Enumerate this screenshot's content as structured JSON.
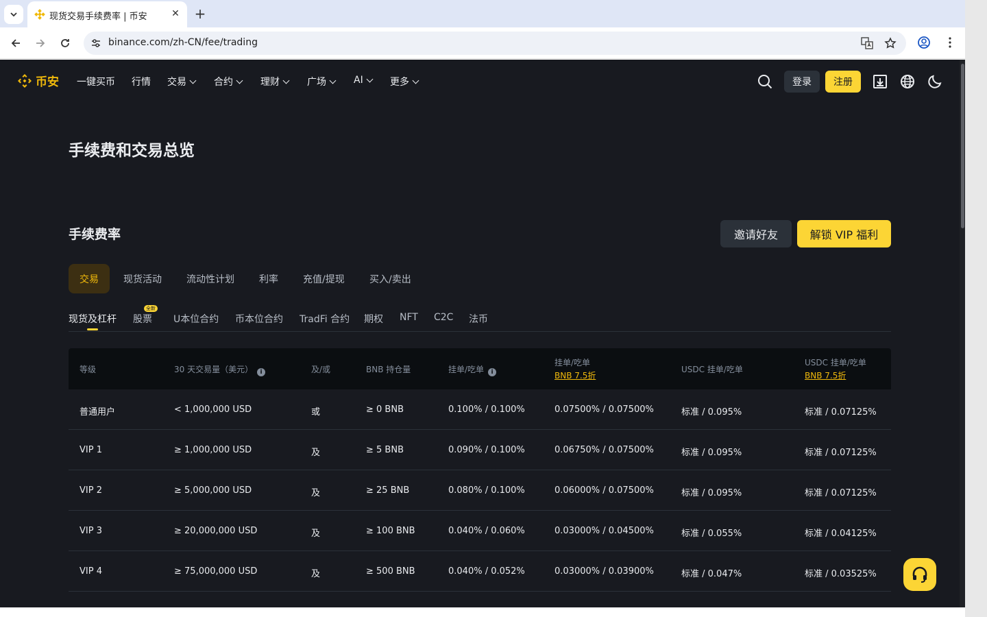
{
  "browser": {
    "tab_title": "现货交易手续费率 | 币安",
    "tab_close": "✕",
    "new_tab": "+",
    "url": "binance.com/zh-CN/fee/trading"
  },
  "header": {
    "logo_text": "币安",
    "nav": [
      "一键买币",
      "行情",
      "交易",
      "合约",
      "理财",
      "广场",
      "AI",
      "更多"
    ],
    "login": "登录",
    "register": "注册"
  },
  "page_title": "手续费和交易总览",
  "section": {
    "title": "手续费率",
    "invite": "邀请好友",
    "vip": "解锁 VIP 福利"
  },
  "category_tabs": [
    "交易",
    "现货活动",
    "流动性计划",
    "利率",
    "充值/提现",
    "买入/卖出"
  ],
  "sub_tabs": [
    "现货及杠杆",
    "股票",
    "U本位合约",
    "币本位合约",
    "TradFi 合约",
    "期权",
    "NFT",
    "C2C",
    "法币"
  ],
  "new_badge": "全新",
  "table": {
    "headers": {
      "level": "等级",
      "volume": "30 天交易量（美元）",
      "andor": "及/或",
      "bnb": "BNB 持仓量",
      "maker_taker": "挂单/吃单",
      "maker_taker_bnb": "挂单/吃单",
      "bnb_discount": "BNB 7.5折",
      "usdc": "USDC 挂单/吃单",
      "usdc_bnb": "USDC 挂单/吃单",
      "usdc_bnb_discount": "BNB 7.5折"
    },
    "rows": [
      {
        "level": "普通用户",
        "volume": "< 1,000,000 USD",
        "andor": "或",
        "bnb": "≥ 0 BNB",
        "mt": "0.100% / 0.100%",
        "mt_bnb": "0.07500% / 0.07500%",
        "usdc": "标准 / 0.095%",
        "usdc_bnb": "标准 / 0.07125%"
      },
      {
        "level": "VIP 1",
        "volume": "≥ 1,000,000 USD",
        "andor": "及",
        "bnb": "≥ 5 BNB",
        "mt": "0.090% / 0.100%",
        "mt_bnb": "0.06750% / 0.07500%",
        "usdc": "标准 / 0.095%",
        "usdc_bnb": "标准 / 0.07125%"
      },
      {
        "level": "VIP 2",
        "volume": "≥ 5,000,000 USD",
        "andor": "及",
        "bnb": "≥ 25 BNB",
        "mt": "0.080% / 0.100%",
        "mt_bnb": "0.06000% / 0.07500%",
        "usdc": "标准 / 0.095%",
        "usdc_bnb": "标准 / 0.07125%"
      },
      {
        "level": "VIP 3",
        "volume": "≥ 20,000,000 USD",
        "andor": "及",
        "bnb": "≥ 100 BNB",
        "mt": "0.040% / 0.060%",
        "mt_bnb": "0.03000% / 0.04500%",
        "usdc": "标准 / 0.055%",
        "usdc_bnb": "标准 / 0.04125%"
      },
      {
        "level": "VIP 4",
        "volume": "≥ 75,000,000 USD",
        "andor": "及",
        "bnb": "≥ 500 BNB",
        "mt": "0.040% / 0.052%",
        "mt_bnb": "0.03000% / 0.03900%",
        "usdc": "标准 / 0.047%",
        "usdc_bnb": "标准 / 0.03525%"
      }
    ]
  },
  "colors": {
    "accent": "#f0b90b",
    "background": "#181a20"
  }
}
